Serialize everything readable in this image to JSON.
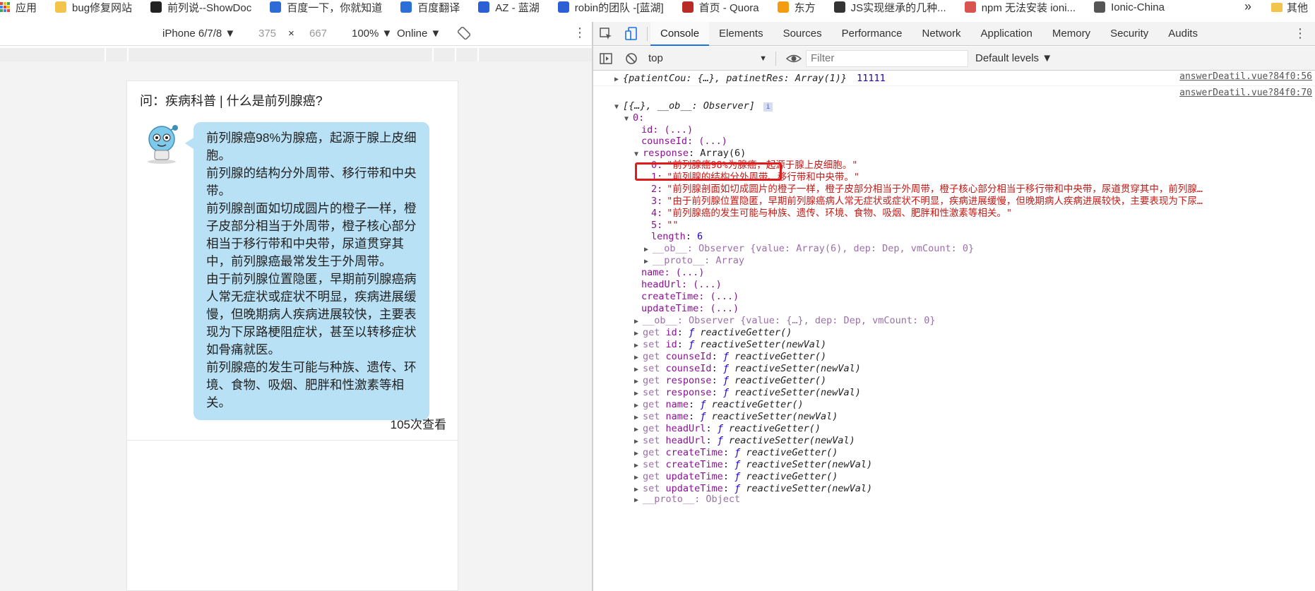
{
  "bookmarks": [
    {
      "label": "应用",
      "icon": "apps-grid-icon"
    },
    {
      "label": "bug修复网站",
      "icon": "folder-icon"
    },
    {
      "label": "前列说--ShowDoc",
      "icon": "showdoc-icon"
    },
    {
      "label": "百度一下，你就知道",
      "icon": "baidu-paw-icon"
    },
    {
      "label": "百度翻译",
      "icon": "translate-icon"
    },
    {
      "label": "AZ - 蓝湖",
      "icon": "lanhu-icon"
    },
    {
      "label": "robin的团队 -[蓝湖]",
      "icon": "lanhu-icon"
    },
    {
      "label": "首页 - Quora",
      "icon": "quora-icon"
    },
    {
      "label": "东方",
      "icon": "star-icon"
    },
    {
      "label": "JS实现继承的几种...",
      "icon": "bookmark-page-icon"
    },
    {
      "label": "npm 无法安装 ioni...",
      "icon": "jianshu-icon"
    },
    {
      "label": "Ionic-China",
      "icon": "globe-icon"
    }
  ],
  "bookmarks_more": "»",
  "bookmarks_other": "其他",
  "device_toolbar": {
    "device": "iPhone 6/7/8 ▼",
    "width": "375",
    "times": "×",
    "height": "667",
    "zoom": "100% ▼",
    "network": "Online ▼"
  },
  "phone": {
    "title": "问：疾病科普 | 什么是前列腺癌?",
    "answer": [
      "前列腺癌98%为腺癌，起源于腺上皮细胞。",
      "前列腺的结构分外周带、移行带和中央带。",
      "前列腺剖面如切成圆片的橙子一样，橙子皮部分相当于外周带，橙子核心部分相当于移行带和中央带，尿道贯穿其中，前列腺癌最常发生于外周带。",
      "由于前列腺位置隐匿，早期前列腺癌病人常无症状或症状不明显，疾病进展缓慢，但晚期病人疾病进展较快，主要表现为下尿路梗阻症状，甚至以转移症状如骨痛就医。",
      "前列腺癌的发生可能与种族、遗传、环境、食物、吸烟、肥胖和性激素等相关。"
    ],
    "views": "105次查看"
  },
  "devtools": {
    "tabs": [
      "Console",
      "Elements",
      "Sources",
      "Performance",
      "Network",
      "Application",
      "Memory",
      "Security",
      "Audits"
    ],
    "active_tab": "Console",
    "context": "top",
    "filter_placeholder": "Filter",
    "levels": "Default levels ▼"
  },
  "console": {
    "line1": {
      "text": "{patientCou: {…}, patinetRes: Array(1)}",
      "value": "11111",
      "source": "answerDeatil.vue?84f0:56"
    },
    "line2": {
      "text": "[{…}, __ob__: Observer]",
      "source": "answerDeatil.vue?84f0:70"
    },
    "index0": "0:",
    "id": "id: (...)",
    "counseId": "counseId: (...)",
    "response_key": "response",
    "response_val": ": Array(6)",
    "items": [
      {
        "idx": "0:",
        "val": "\"前列腺癌98%为腺癌，起源于腺上皮细胞。\""
      },
      {
        "idx": "1:",
        "val": "\"前列腺的结构分外周带、移行带和中央带。\""
      },
      {
        "idx": "2:",
        "val": "\"前列腺剖面如切成圆片的橙子一样，橙子皮部分相当于外周带，橙子核心部分相当于移行带和中央带，尿道贯穿其中，前列腺…"
      },
      {
        "idx": "3:",
        "val": "\"由于前列腺位置隐匿，早期前列腺癌病人常无症状或症状不明显，疾病进展缓慢，但晚期病人疾病进展较快，主要表现为下尿…"
      },
      {
        "idx": "4:",
        "val": "\"前列腺癌的发生可能与种族、遗传、环境、食物、吸烟、肥胖和性激素等相关。\""
      },
      {
        "idx": "5:",
        "val": "\"\""
      }
    ],
    "length_key": "length",
    "length_val": "6",
    "ob_line": "__ob__: Observer {value: Array(6), dep: Dep, vmCount: 0}",
    "proto_array": "__proto__: Array",
    "name": "name: (...)",
    "headUrl": "headUrl: (...)",
    "createTime": "createTime: (...)",
    "updateTime": "updateTime: (...)",
    "ob_line2": "__ob__: Observer {value: {…}, dep: Dep, vmCount: 0}",
    "accessors": [
      {
        "kind": "get",
        "prop": "id",
        "fn": "reactiveGetter()"
      },
      {
        "kind": "set",
        "prop": "id",
        "fn": "reactiveSetter(newVal)"
      },
      {
        "kind": "get",
        "prop": "counseId",
        "fn": "reactiveGetter()"
      },
      {
        "kind": "set",
        "prop": "counseId",
        "fn": "reactiveSetter(newVal)"
      },
      {
        "kind": "get",
        "prop": "response",
        "fn": "reactiveGetter()"
      },
      {
        "kind": "set",
        "prop": "response",
        "fn": "reactiveSetter(newVal)"
      },
      {
        "kind": "get",
        "prop": "name",
        "fn": "reactiveGetter()"
      },
      {
        "kind": "set",
        "prop": "name",
        "fn": "reactiveSetter(newVal)"
      },
      {
        "kind": "get",
        "prop": "headUrl",
        "fn": "reactiveGetter()"
      },
      {
        "kind": "set",
        "prop": "headUrl",
        "fn": "reactiveSetter(newVal)"
      },
      {
        "kind": "get",
        "prop": "createTime",
        "fn": "reactiveGetter()"
      },
      {
        "kind": "set",
        "prop": "createTime",
        "fn": "reactiveSetter(newVal)"
      },
      {
        "kind": "get",
        "prop": "updateTime",
        "fn": "reactiveGetter()"
      },
      {
        "kind": "set",
        "prop": "updateTime",
        "fn": "reactiveSetter(newVal)"
      }
    ],
    "proto_object": "__proto__: Object"
  },
  "colors": {
    "bubble": "#b9e1f5",
    "accent": "#1a73e8",
    "highlight_box": "#e01b1b",
    "string": "#c41a16",
    "key": "#881391"
  }
}
